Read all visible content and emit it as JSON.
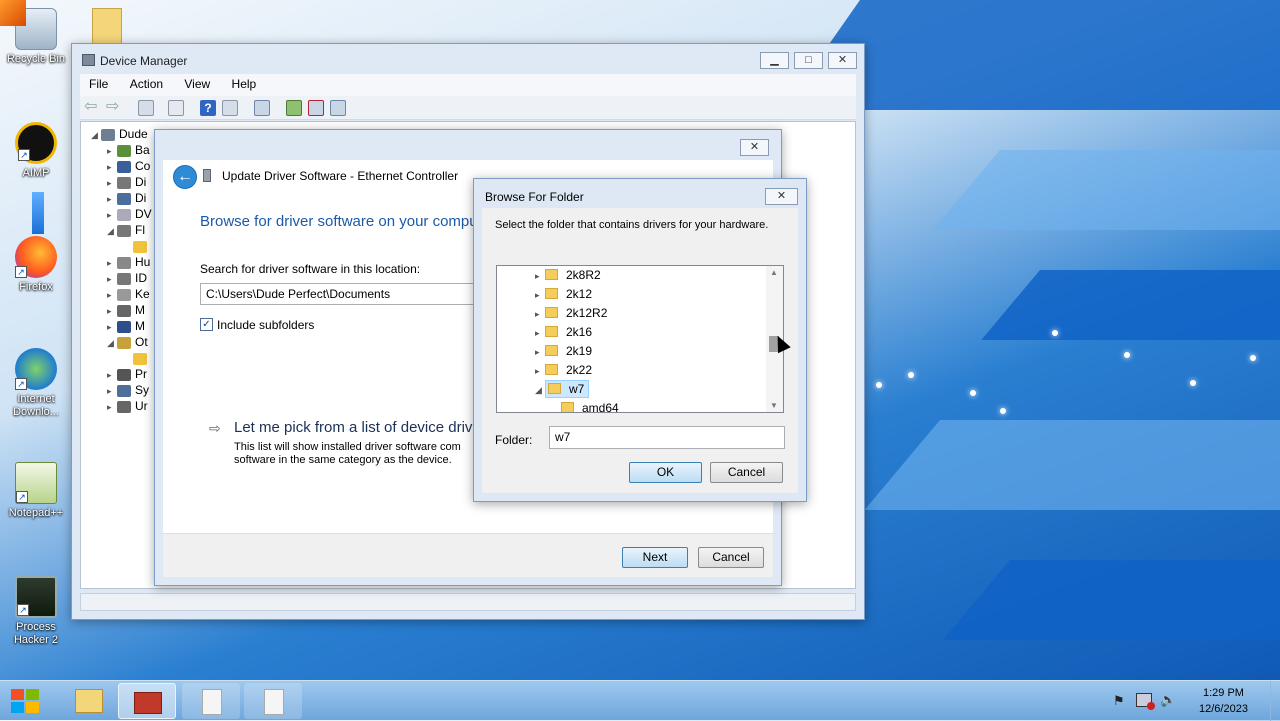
{
  "desktop": {
    "icons": [
      {
        "label": "Recycle Bin"
      },
      {
        "label": "AIMP"
      },
      {
        "label": "Firefox"
      },
      {
        "label": "Internet Downlo..."
      },
      {
        "label": "Notepad++"
      },
      {
        "label": "Process Hacker 2"
      }
    ]
  },
  "device_manager": {
    "title": "Device Manager",
    "menu": [
      "File",
      "Action",
      "View",
      "Help"
    ],
    "tree": {
      "root": "Dude",
      "items": [
        "Ba",
        "Co",
        "Di",
        "Di",
        "DV",
        "Fl",
        "Hu",
        "ID",
        "Ke",
        "M",
        "M",
        "Ot",
        "Pr",
        "Sy",
        "Ur"
      ]
    }
  },
  "wizard": {
    "title": "Update Driver Software - Ethernet Controller",
    "heading": "Browse for driver software on your compu",
    "search_label": "Search for driver software in this location:",
    "path_value": "C:\\Users\\Dude Perfect\\Documents",
    "include_subfolders": "Include subfolders",
    "pick_heading": "Let me pick from a list of device driv",
    "pick_desc_line1": "This list will show installed driver software com",
    "pick_desc_line2": "software in the same category as the device.",
    "next": "Next",
    "cancel": "Cancel"
  },
  "browse": {
    "title": "Browse For Folder",
    "instruction": "Select the folder that contains drivers for your hardware.",
    "folders": [
      "2k8R2",
      "2k12",
      "2k12R2",
      "2k16",
      "2k19",
      "2k22",
      "w7",
      "amd64"
    ],
    "selected": "w7",
    "folder_label": "Folder:",
    "folder_value": "w7",
    "ok": "OK",
    "cancel": "Cancel"
  },
  "taskbar": {
    "time": "1:29 PM",
    "date": "12/6/2023"
  },
  "colors": {
    "accent": "#2e8bd6",
    "selection": "#cce8ff",
    "heading_blue": "#1c5aa6"
  }
}
